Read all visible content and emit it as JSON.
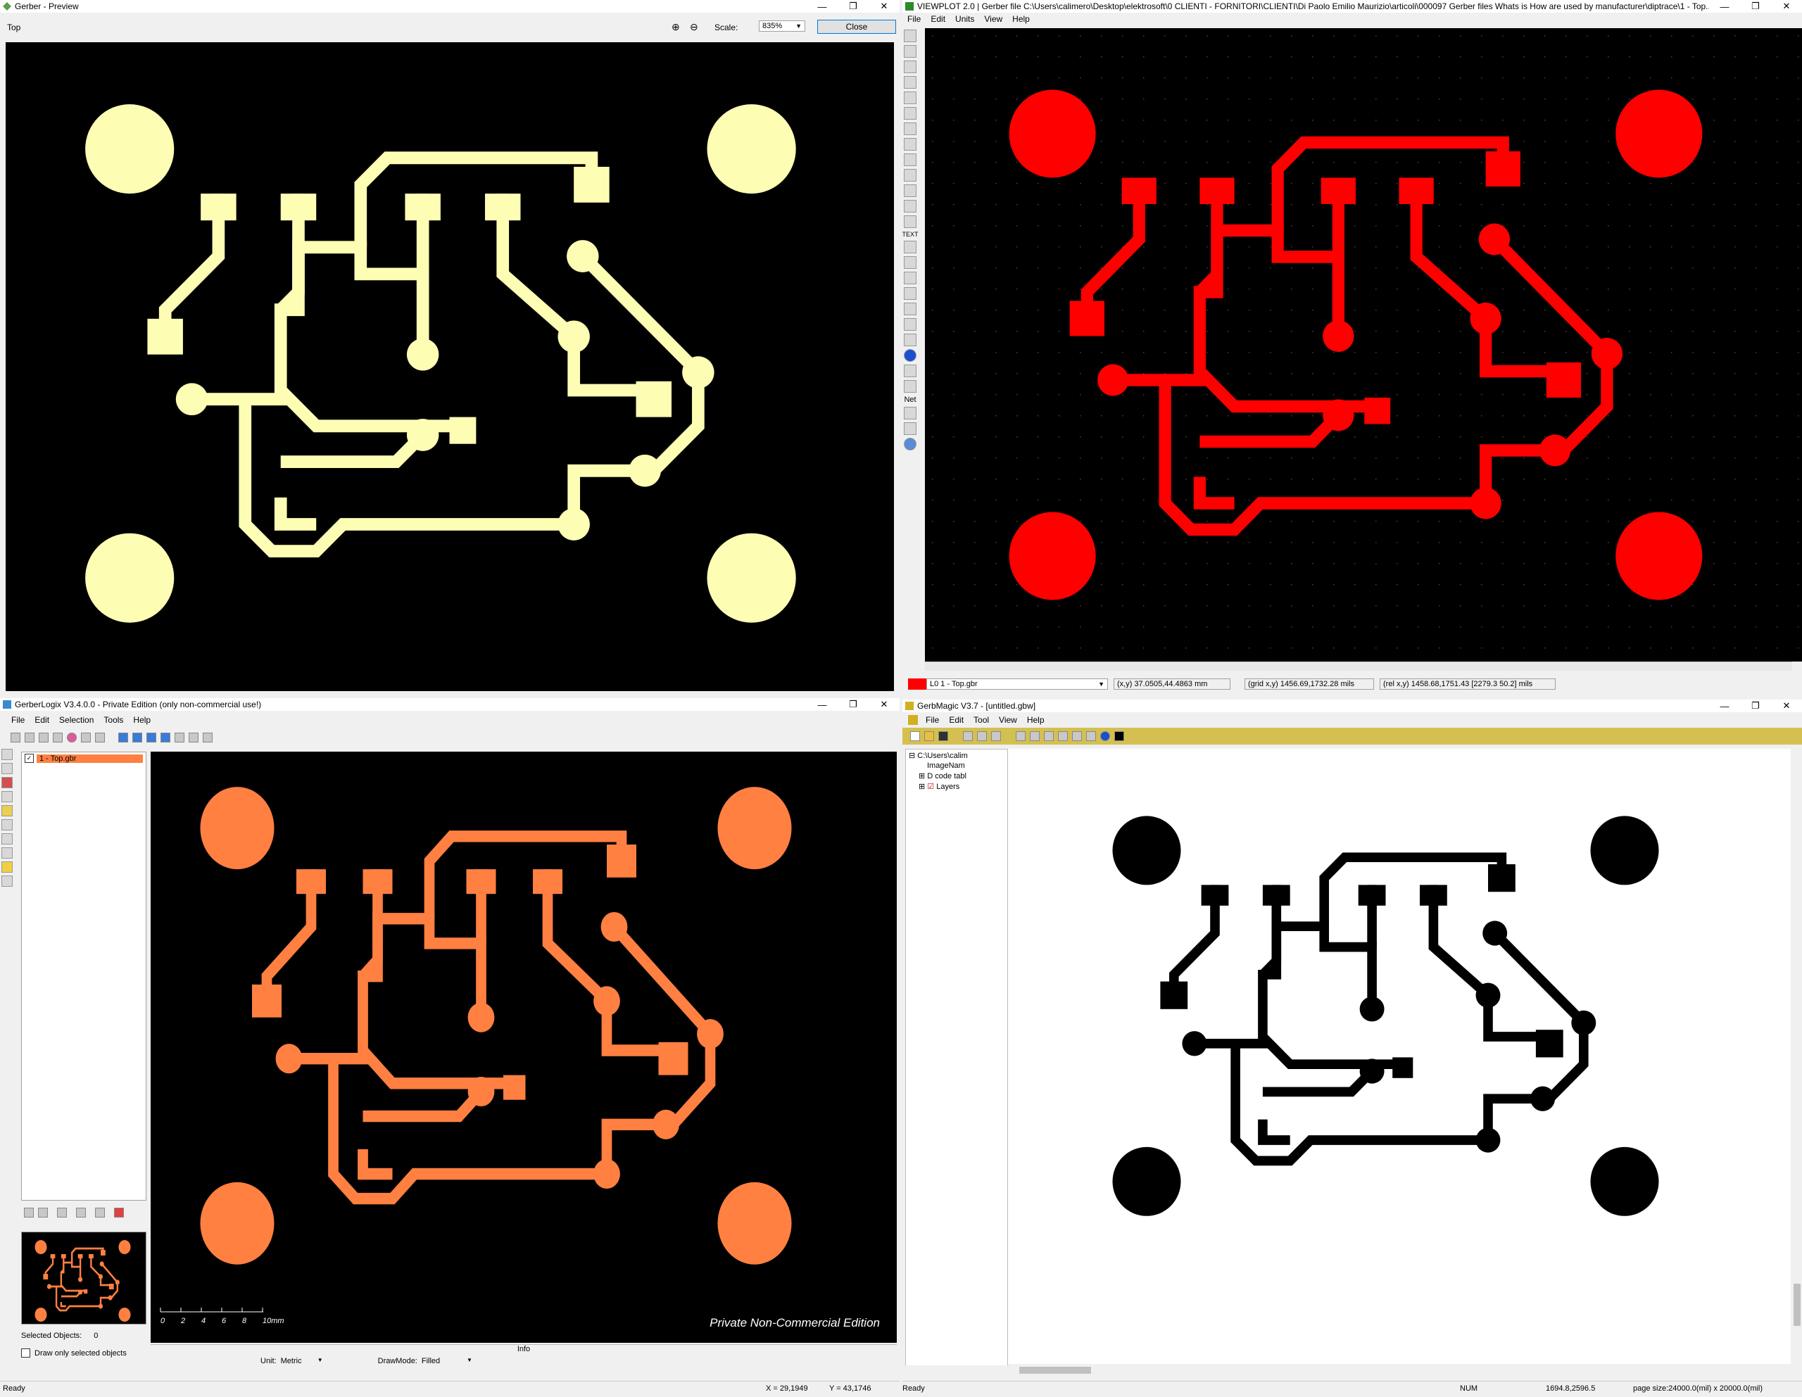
{
  "gerber_preview": {
    "title": "Gerber - Preview",
    "layer_label": "Top",
    "scale_label": "Scale:",
    "scale_value": "835%",
    "close_label": "Close",
    "trace_color": "#fefdb4"
  },
  "viewplot": {
    "title": "VIEWPLOT 2.0  |  Gerber file C:\\Users\\calimero\\Desktop\\elektrosoft\\0 CLIENTI - FORNITORI\\CLIENTI\\Di Paolo Emilio Maurizio\\articoli\\000097 Gerber files Whats is How are used by manufacturer\\diptrace\\1 - Top....",
    "menu": [
      "File",
      "Edit",
      "Units",
      "View",
      "Help"
    ],
    "layer_select": "L0  1 - Top.gbr",
    "coord_xy": "(x,y) 37.0505,44.4863 mm",
    "coord_grid": "(grid x,y) 1456.69,1732.28 mils",
    "coord_rel": "(rel x,y) 1458.68,1751.43 [2279.3 50.2] mils",
    "text_tool": "TEXT",
    "net_tool": "Net",
    "trace_color": "#ff0000"
  },
  "gerberlogix": {
    "title": "GerberLogix V3.4.0.0  -  Private Edition (only non-commercial use!)",
    "menu": [
      "File",
      "Edit",
      "Selection",
      "Tools",
      "Help"
    ],
    "layer_item": "1 - Top.gbr",
    "selected_objects_label": "Selected Objects:",
    "selected_objects_value": "0",
    "draw_only_label": "Draw only selected objects",
    "watermark": "Private Non-Commercial Edition",
    "info_label": "Info",
    "unit_label": "Unit:",
    "unit_value": "Metric",
    "drawmode_label": "DrawMode:",
    "drawmode_value": "Filled",
    "status_ready": "Ready",
    "status_x": "X = 29,1949",
    "status_y": "Y = 43,1746",
    "scale_ticks": [
      "0",
      "2",
      "4",
      "6",
      "8",
      "10mm"
    ],
    "trace_color": "#ff8041"
  },
  "gerbmagic": {
    "title": "GerbMagic V3.7 - [untitled.gbw]",
    "menu": [
      "File",
      "Edit",
      "Tool",
      "View",
      "Help"
    ],
    "tree": [
      "C:\\Users\\calim",
      "ImageNam",
      "D code tabl",
      "Layers"
    ],
    "status_ready": "Ready",
    "status_num": "NUM",
    "status_coords": "1694.8,2596.5",
    "status_page": "page size:24000.0(mil) x 20000.0(mil)",
    "trace_color": "#000000"
  }
}
